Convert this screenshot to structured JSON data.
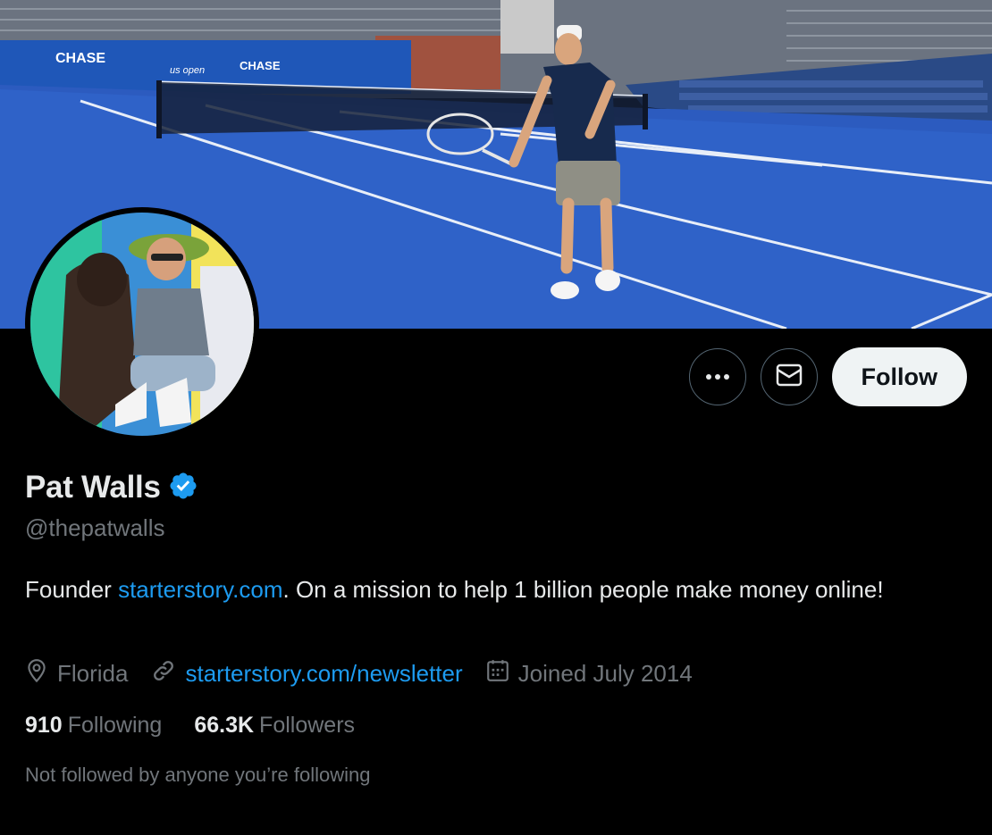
{
  "profile": {
    "display_name": "Pat Walls",
    "handle": "@thepatwalls",
    "verified": true,
    "bio_prefix": "Founder ",
    "bio_link": "starterstory.com",
    "bio_suffix": ". On a mission to help 1 billion people make money online!",
    "location": "Florida",
    "website": "starterstory.com/newsletter",
    "joined": "Joined July 2014",
    "following_count": "910",
    "following_label": "Following",
    "followers_count": "66.3K",
    "followers_label": "Followers",
    "mutuals_text": "Not followed by anyone you’re following"
  },
  "actions": {
    "follow_label": "Follow",
    "more_icon": "more-icon",
    "message_icon": "mail-icon"
  },
  "banner": {
    "sponsor_text": "CHASE",
    "event_text": "us open"
  },
  "colors": {
    "background": "#000000",
    "link": "#1d9bf0",
    "verified": "#1d9bf0",
    "secondary_text": "#71767b",
    "follow_button_bg": "#eff3f4"
  }
}
